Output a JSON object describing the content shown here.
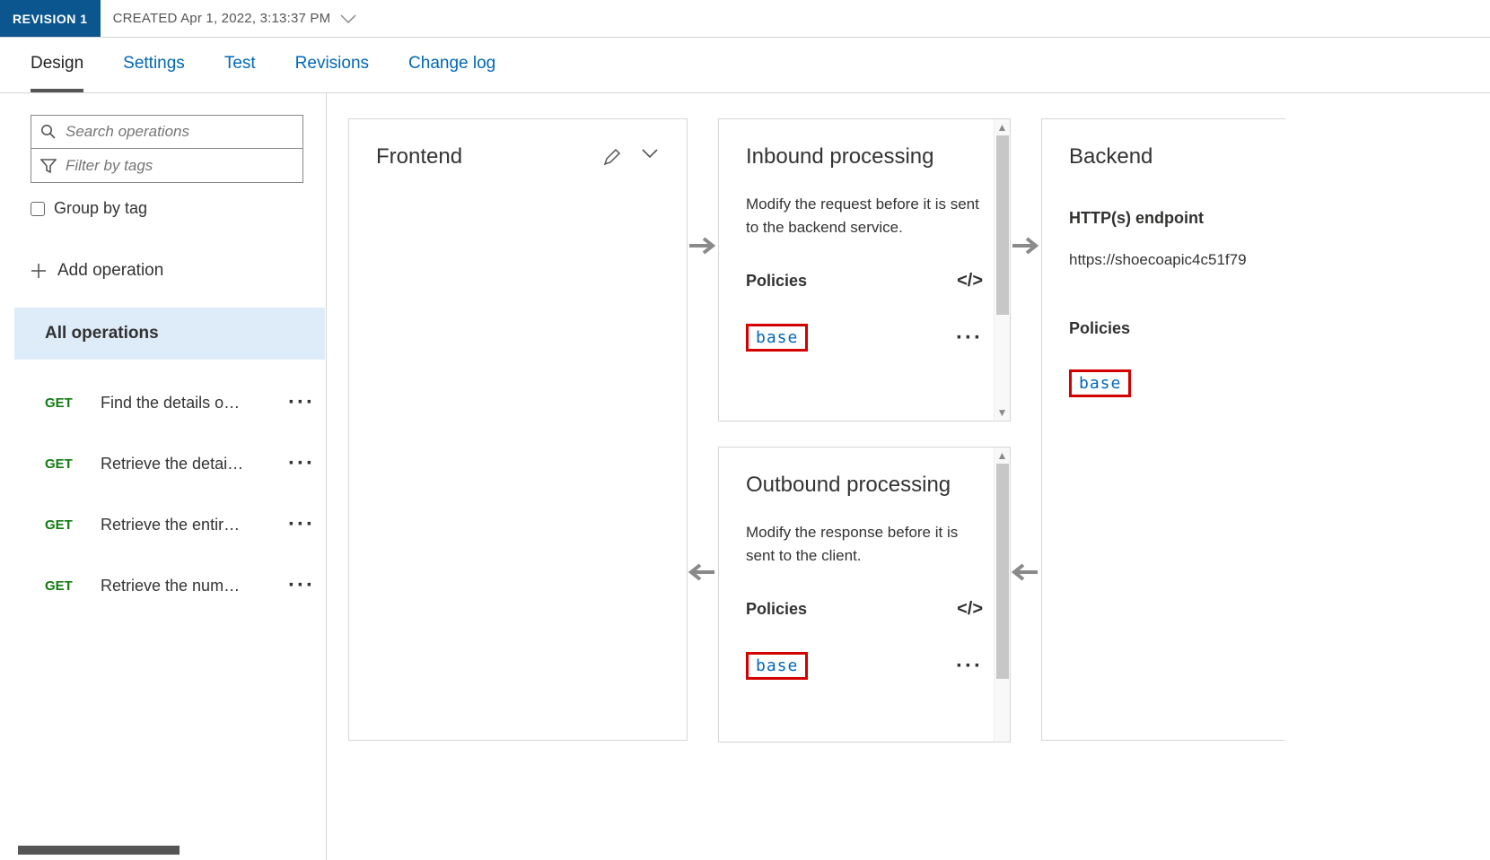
{
  "header": {
    "revision_label": "REVISION 1",
    "created_label": "CREATED Apr 1, 2022, 3:13:37 PM"
  },
  "tabs": [
    {
      "label": "Design",
      "active": true
    },
    {
      "label": "Settings",
      "active": false
    },
    {
      "label": "Test",
      "active": false
    },
    {
      "label": "Revisions",
      "active": false
    },
    {
      "label": "Change log",
      "active": false
    }
  ],
  "sidebar": {
    "search_placeholder": "Search operations",
    "filter_placeholder": "Filter by tags",
    "group_by_tag_label": "Group by tag",
    "add_operation_label": "Add operation",
    "all_operations_label": "All operations",
    "operations": [
      {
        "method": "GET",
        "name": "Find the details o…"
      },
      {
        "method": "GET",
        "name": "Retrieve the detai…"
      },
      {
        "method": "GET",
        "name": "Retrieve the entir…"
      },
      {
        "method": "GET",
        "name": "Retrieve the num…"
      }
    ]
  },
  "frontend": {
    "title": "Frontend"
  },
  "inbound": {
    "title": "Inbound processing",
    "desc": "Modify the request before it is sent to the backend service.",
    "policies_label": "Policies",
    "base_label": "base"
  },
  "outbound": {
    "title": "Outbound processing",
    "desc": "Modify the response before it is sent to the client.",
    "policies_label": "Policies",
    "base_label": "base"
  },
  "backend": {
    "title": "Backend",
    "endpoint_label": "HTTP(s) endpoint",
    "endpoint_url": "https://shoecoapic4c51f79",
    "policies_label": "Policies",
    "base_label": "base"
  }
}
